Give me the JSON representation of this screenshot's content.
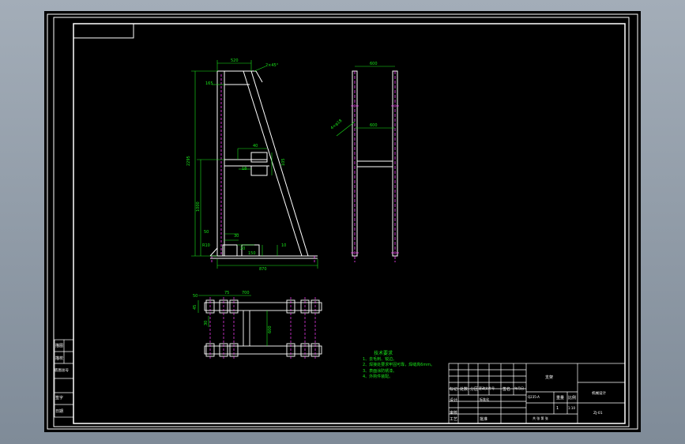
{
  "colors": {
    "background": "#000000",
    "frame": "#ffffff",
    "dimension": "#19e61a",
    "hidden": "#ff40ff",
    "viewport": "#8e9aa7"
  },
  "front_view": {
    "dim_top": "520",
    "dim_chamfer": "2×45°",
    "dim_bracket": "165",
    "dim_height_total": "2295",
    "dim_height_mid": "1000",
    "dim_mid_a": "40",
    "dim_mid_b": "18",
    "dim_mid_c": "105",
    "dim_bottom_a": "50",
    "dim_bottom_b": "30",
    "dim_bottom_c": "20",
    "dim_bottom_d": "150",
    "dim_bottom_e": "10",
    "dim_base": "870",
    "dim_foot_angle": "R10"
  },
  "side_view": {
    "dim_top": "600",
    "dim_mid": "600",
    "dim_diag": "4×φ18"
  },
  "plan_view": {
    "dim_a": "50",
    "dim_b": "75",
    "dim_c": "700",
    "dim_d": "45",
    "dim_e": "30",
    "dim_f": "600"
  },
  "notes": {
    "title": "技术要求",
    "items": [
      "1、去毛刺、锐边。",
      "2、焊接处要求牢固可靠，焊缝高6mm。",
      "3、表面涂防锈漆。",
      "4、外购件装配。"
    ]
  },
  "left_strip": [
    "描图",
    "描校",
    "底图总号",
    "签字",
    "日期"
  ],
  "title_block": {
    "drawing_name": "支架",
    "material": "Q235-A",
    "scale": "1:10",
    "sheet": "1",
    "company": "机械设计",
    "code": "ZJ-01",
    "headers": [
      "标记",
      "处数",
      "分区",
      "更改文件号",
      "签名",
      "年月日"
    ],
    "rows": [
      "设计",
      "审核",
      "工艺"
    ],
    "standard": "标准化",
    "approve": "批准",
    "weight": "重量",
    "ratio": "比例",
    "total": "共  张  第  张"
  }
}
